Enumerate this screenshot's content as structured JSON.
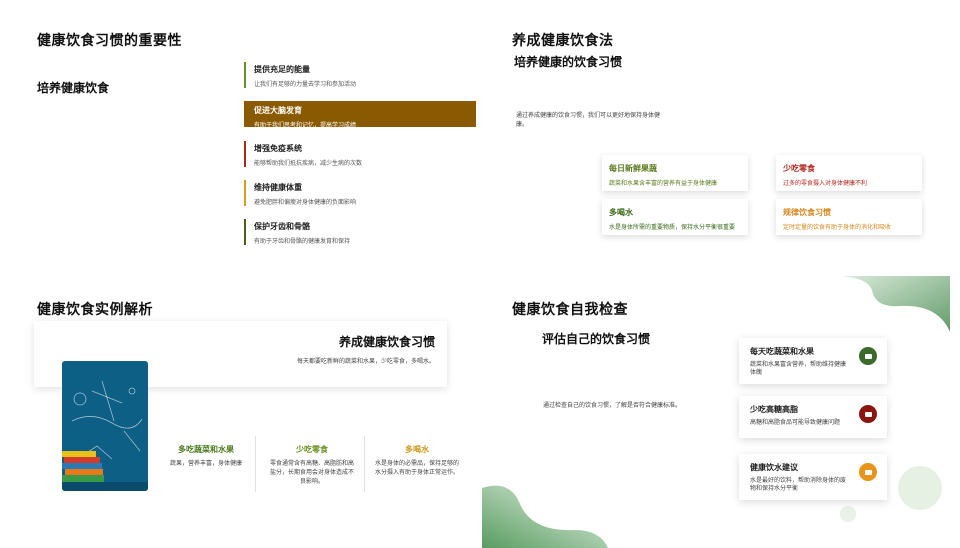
{
  "slide1": {
    "title": "健康饮食习惯的重要性",
    "subtitle": "培养健康饮食",
    "benefits": [
      {
        "title": "提供充足的能量",
        "desc": "让我们有足够的力量去学习和参加活动"
      },
      {
        "title": "促进大脑发育",
        "desc": "有助于我们思考和记忆，提高学习成绩"
      },
      {
        "title": "增强免疫系统",
        "desc": "能够帮助我们抵抗疾病，减少生病的次数"
      },
      {
        "title": "维持健康体重",
        "desc": "避免肥胖和偏瘦对身体健康的负面影响"
      },
      {
        "title": "保护牙齿和骨骼",
        "desc": "有助于牙齿和骨骼的健康发育和保持"
      }
    ],
    "colors": {
      "highlight": "#8a5a00",
      "accent_green": "#6b8e23",
      "accent_red": "#b0271e",
      "accent_orange": "#d4a017",
      "accent_dark": "#4a5d23"
    }
  },
  "slide2": {
    "title": "养成健康饮食法",
    "subtitle": "培养健康的饮食习惯",
    "intro": "通过养成健康的饮食习惯，我们可以更好地保持身体健康。",
    "cards": [
      {
        "title": "每日新鲜果蔬",
        "desc": "蔬菜和水果含丰富的营养有益于身体健康"
      },
      {
        "title": "少吃零食",
        "desc": "过多的零食摄入对身体健康不利"
      },
      {
        "title": "多喝水",
        "desc": "水是身体所需的重要物质，保持水分平衡很重要"
      },
      {
        "title": "规律饮食习惯",
        "desc": "定时定量的饮食有助于身体的消化和吸收"
      }
    ]
  },
  "slide3": {
    "title": "健康饮食实例解析",
    "card_title": "养成健康饮食习惯",
    "card_desc": "每天都要吃新鲜的蔬菜和水果，少吃零食，多喝水。",
    "items": [
      {
        "title": "多吃蔬菜和水果",
        "desc": "蔬果，营养丰富，身体健康",
        "color": "#4a7a1e"
      },
      {
        "title": "少吃零食",
        "desc": "零食通常含有高糖、高脂肪和高盐分，长期食用会对身体造成不良影响。",
        "color": "#6b8e23"
      },
      {
        "title": "多喝水",
        "desc": "水是身体的必需品，保持足够的水分摄入有助于身体正常运作。",
        "color": "#c89a1a"
      }
    ]
  },
  "slide4": {
    "title": "健康饮食自我检查",
    "subtitle": "评估自己的饮食习惯",
    "intro": "通过检查自己的饮食习惯，了解是否符合健康标准。",
    "cards": [
      {
        "title": "每天吃蔬菜和水果",
        "desc": "蔬菜和水果富含营养，帮助维持健康体魄",
        "icon": "fruit-icon",
        "color": "#3c6a2a"
      },
      {
        "title": "少吃高糖高脂",
        "desc": "高糖和高脂食品可能导致健康问题",
        "icon": "warning-icon",
        "color": "#8a1410"
      },
      {
        "title": "健康饮水建议",
        "desc": "水是最好的饮料，帮助消除身体的废物和保持水分平衡",
        "icon": "water-icon",
        "color": "#e8941a"
      }
    ]
  }
}
